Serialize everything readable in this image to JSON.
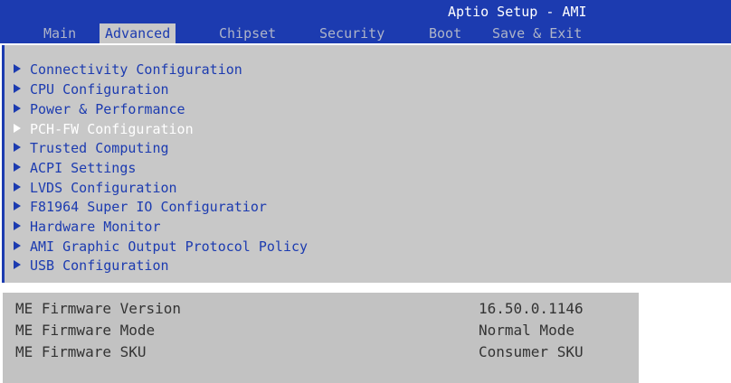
{
  "header": {
    "title": "Aptio Setup - AMI",
    "tabs": [
      {
        "label": "Main",
        "active": false
      },
      {
        "label": "Advanced",
        "active": true
      },
      {
        "label": "Chipset",
        "active": false
      },
      {
        "label": "Security",
        "active": false
      },
      {
        "label": "Boot",
        "active": false
      },
      {
        "label": "Save & Exit",
        "active": false
      }
    ]
  },
  "menu": {
    "items": [
      {
        "label": "Connectivity Configuration"
      },
      {
        "label": "CPU Configuration"
      },
      {
        "label": "Power & Performance"
      },
      {
        "label": "PCH-FW Configuration",
        "selected": true
      },
      {
        "label": "Trusted Computing"
      },
      {
        "label": "ACPI Settings"
      },
      {
        "label": "LVDS Configuration"
      },
      {
        "label": "F81964 Super IO Configuratior"
      },
      {
        "label": "Hardware Monitor"
      },
      {
        "label": "AMI Graphic Output Protocol Policy"
      },
      {
        "label": "USB Configuration"
      }
    ]
  },
  "me_info": {
    "rows": [
      {
        "label": "ME Firmware Version",
        "value": "16.50.0.1146"
      },
      {
        "label": "ME Firmware Mode",
        "value": "Normal Mode"
      },
      {
        "label": "ME Firmware SKU",
        "value": "Consumer SKU"
      }
    ]
  },
  "colors": {
    "header_bg": "#1c3bb0",
    "content_bg": "#c8c8c8",
    "item_text": "#1c3bb0",
    "selected_text": "#ffffff",
    "me_panel_bg": "#c2c2c2"
  }
}
